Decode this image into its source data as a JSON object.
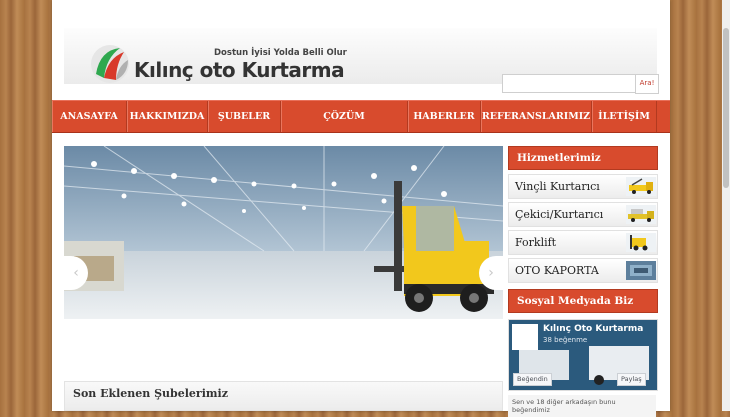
{
  "header": {
    "slogan": "Dostun İyisi Yolda Belli Olur",
    "logo_text": "Kılınç oto Kurtarma",
    "search": {
      "placeholder": "",
      "button_label": "Ara!"
    }
  },
  "nav": {
    "items": [
      "ANASAYFA",
      "HAKKIMIZDA",
      "ŞUBELER",
      "ÇÖZÜM ORTAKLARIMIZ",
      "HABERLER",
      "REFERANSLARIMIZ",
      "İLETİŞİM"
    ]
  },
  "slider": {
    "prev_label": "‹",
    "next_label": "›"
  },
  "sidebar": {
    "services_heading": "Hizmetlerimiz",
    "services": [
      "Vinçli Kurtarıcı",
      "Çekici/Kurtarıcı",
      "Forklift",
      "OTO KAPORTA"
    ],
    "social_heading": "Sosyal Medyada Biz",
    "facebook": {
      "page_name": "Kılınç Oto Kurtarma",
      "likes": "38 beğenme",
      "like_button": "Beğendin",
      "share_button": "Paylaş",
      "friends_text": "Sen ve 18 diğer arkadaşın bunu beğendimiz"
    }
  },
  "main": {
    "branches_heading": "Son Eklenen Şubelerimiz"
  },
  "colors": {
    "accent": "#d84b2d",
    "background_wood": "#a6713f"
  }
}
